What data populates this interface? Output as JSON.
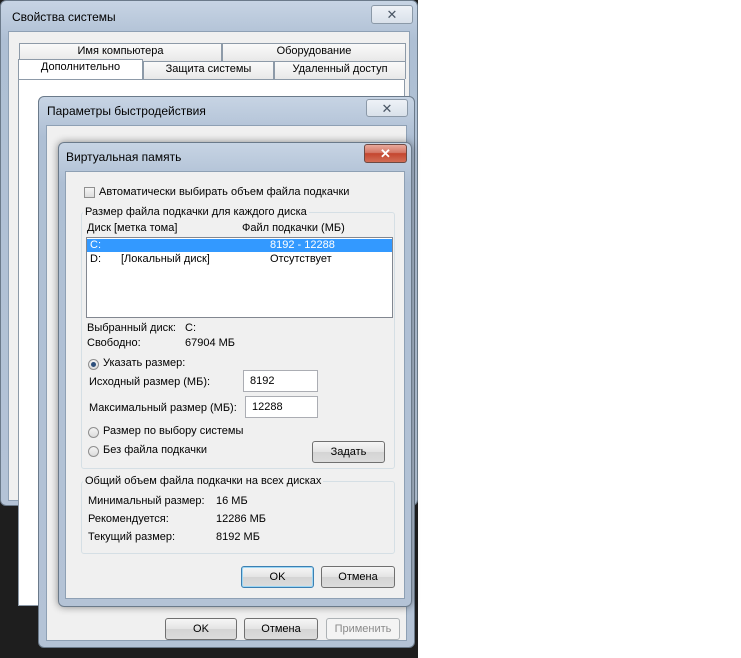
{
  "system_props": {
    "title": "Свойства системы",
    "close": "✕",
    "tabs_top": [
      "Имя компьютера",
      "Оборудование"
    ],
    "tabs_bottom": [
      "Дополнительно",
      "Защита системы",
      "Удаленный доступ"
    ],
    "ok": "OK",
    "cancel": "Отмена",
    "apply": "Применить"
  },
  "perf": {
    "title": "Параметры быстродействия",
    "close": "✕"
  },
  "vm": {
    "title": "Виртуальная память",
    "close": "✕",
    "auto_label": "Автоматически выбирать объем файла подкачки",
    "auto_checked": false,
    "group1_label": "Размер файла подкачки для каждого диска",
    "col_disk": "Диск [метка тома]",
    "col_file": "Файл подкачки (МБ)",
    "drives": [
      {
        "drive": "C:",
        "label": "",
        "size": "8192 - 12288",
        "selected": true
      },
      {
        "drive": "D:",
        "label": "[Локальный диск]",
        "size": "Отсутствует",
        "selected": false
      }
    ],
    "selected_disk_label": "Выбранный диск:",
    "selected_disk_value": "C:",
    "free_label": "Свободно:",
    "free_value": "67904 МБ",
    "custom_label": "Указать размер:",
    "initial_label": "Исходный размер (МБ):",
    "initial_value": "8192",
    "max_label": "Максимальный размер (МБ):",
    "max_value": "12288",
    "system_managed_label": "Размер по выбору системы",
    "no_file_label": "Без файла подкачки",
    "set_button": "Задать",
    "selected_option": "custom",
    "group2_label": "Общий объем файла подкачки на всех дисках",
    "min_label": "Минимальный размер:",
    "min_value": "16 МБ",
    "recommended_label": "Рекомендуется:",
    "recommended_value": "12286 МБ",
    "current_label": "Текущий размер:",
    "current_value": "8192 МБ",
    "ok": "OK",
    "cancel": "Отмена"
  }
}
